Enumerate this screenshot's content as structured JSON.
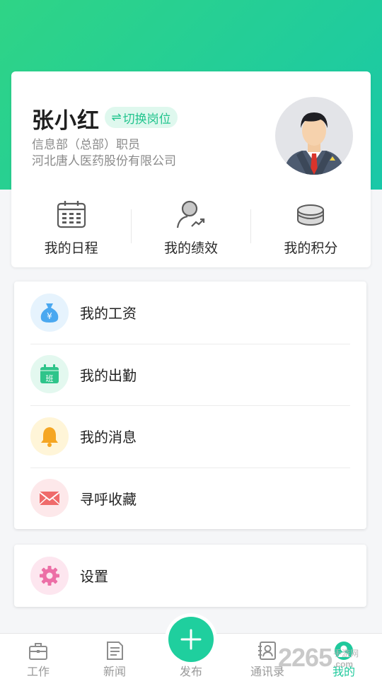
{
  "profile": {
    "name": "张小红",
    "switch_label": "切换岗位",
    "switch_icon": "⇌",
    "department": "信息部（总部）职员",
    "company": "河北唐人医药股份有限公司"
  },
  "quick_actions": [
    {
      "label": "我的日程",
      "icon": "calendar-icon"
    },
    {
      "label": "我的绩效",
      "icon": "performance-icon"
    },
    {
      "label": "我的积分",
      "icon": "coins-icon"
    }
  ],
  "menu": [
    {
      "label": "我的工资",
      "icon": "money-bag-icon",
      "icon_text": "¥",
      "color": "#4aa8f0",
      "bg": "#e6f3fd"
    },
    {
      "label": "我的出勤",
      "icon": "attendance-icon",
      "icon_text": "班",
      "color": "#2ec48a",
      "bg": "#e3f8ef"
    },
    {
      "label": "我的消息",
      "icon": "bell-icon",
      "color": "#f5a623",
      "bg": "#fff5d8"
    },
    {
      "label": "寻呼收藏",
      "icon": "envelope-icon",
      "color": "#ef6b6b",
      "bg": "#fde8ea"
    }
  ],
  "settings": {
    "label": "设置",
    "icon": "gear-icon",
    "color": "#ec6fa6",
    "bg": "#fde6ef"
  },
  "tabbar": [
    {
      "label": "工作",
      "icon": "briefcase-icon"
    },
    {
      "label": "新闻",
      "icon": "news-icon"
    },
    {
      "label": "发布",
      "icon": "plus-icon"
    },
    {
      "label": "通讯录",
      "icon": "contacts-icon"
    },
    {
      "label": "我的",
      "icon": "user-icon",
      "active": true
    }
  ],
  "watermark": {
    "number": "2265",
    "top": "手游网",
    "bottom": ".com"
  },
  "colors": {
    "accent": "#1fc99c",
    "header_start": "#2fd486",
    "header_end": "#19c8a8"
  }
}
